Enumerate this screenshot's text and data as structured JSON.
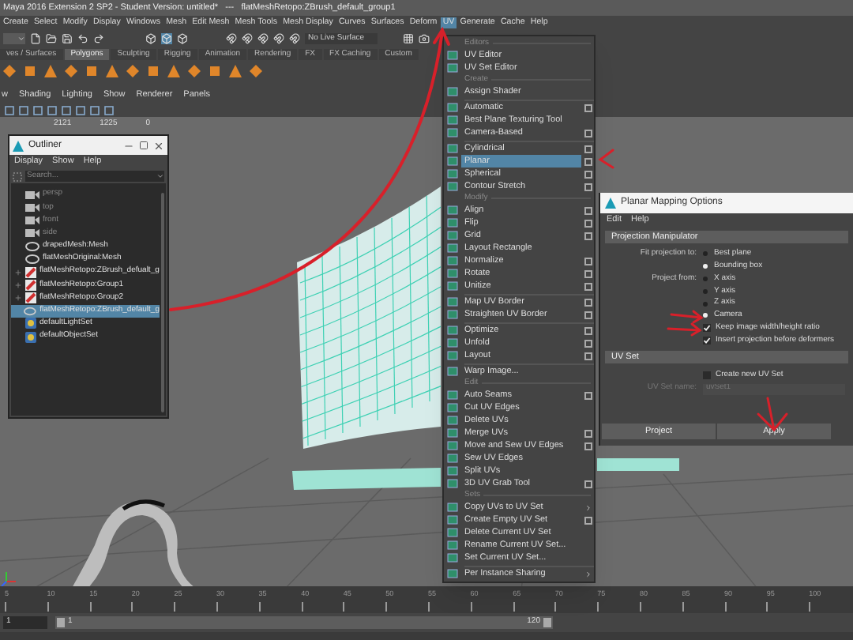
{
  "title": "Maya 2016 Extension 2 SP2 - Student Version: untitled*   ---   flatMeshRetopo:ZBrush_default_group1",
  "menu_bar": [
    {
      "label": "Create",
      "selected": false
    },
    {
      "label": "Select",
      "selected": false
    },
    {
      "label": "Modify",
      "selected": false
    },
    {
      "label": "Display",
      "selected": false
    },
    {
      "label": "Windows",
      "selected": false
    },
    {
      "label": "Mesh",
      "selected": false
    },
    {
      "label": "Edit Mesh",
      "selected": false
    },
    {
      "label": "Mesh Tools",
      "selected": false
    },
    {
      "label": "Mesh Display",
      "selected": false
    },
    {
      "label": "Curves",
      "selected": false
    },
    {
      "label": "Surfaces",
      "selected": false
    },
    {
      "label": "Deform",
      "selected": false
    },
    {
      "label": "UV",
      "selected": true
    },
    {
      "label": "Generate",
      "selected": false
    },
    {
      "label": "Cache",
      "selected": false
    },
    {
      "label": "Help",
      "selected": false
    }
  ],
  "toolbar": {
    "live_surface": "No Live Surface"
  },
  "shelf_tabs": [
    {
      "label": "ves / Surfaces",
      "selected": false
    },
    {
      "label": "Polygons",
      "selected": true
    },
    {
      "label": "Sculpting",
      "selected": false
    },
    {
      "label": "Rigging",
      "selected": false
    },
    {
      "label": "Animation",
      "selected": false
    },
    {
      "label": "Rendering",
      "selected": false
    },
    {
      "label": "FX",
      "selected": false
    },
    {
      "label": "FX Caching",
      "selected": false
    },
    {
      "label": "Custom",
      "selected": false
    }
  ],
  "panel_menu": [
    "w",
    "Shading",
    "Lighting",
    "Show",
    "Renderer",
    "Panels"
  ],
  "stats": [
    "2121",
    "1225",
    "0"
  ],
  "outliner": {
    "title": "Outliner",
    "menu": [
      "Display",
      "Show",
      "Help"
    ],
    "search": {
      "placeholder": "Search..."
    },
    "items": [
      {
        "label": "persp",
        "kind": "camera",
        "dimmed": true,
        "expandable": false,
        "selected": false
      },
      {
        "label": "top",
        "kind": "camera",
        "dimmed": true,
        "expandable": false,
        "selected": false
      },
      {
        "label": "front",
        "kind": "camera",
        "dimmed": true,
        "expandable": false,
        "selected": false
      },
      {
        "label": "side",
        "kind": "camera",
        "dimmed": true,
        "expandable": false,
        "selected": false
      },
      {
        "label": "drapedMesh:Mesh",
        "kind": "mesh",
        "dimmed": false,
        "expandable": false,
        "selected": false
      },
      {
        "label": "flatMeshOriginal:Mesh",
        "kind": "mesh",
        "dimmed": false,
        "expandable": false,
        "selected": false
      },
      {
        "label": "flatMeshRetopo:ZBrush_defualt_g",
        "kind": "group",
        "dimmed": false,
        "expandable": true,
        "selected": false
      },
      {
        "label": "flatMeshRetopo:Group1",
        "kind": "group",
        "dimmed": false,
        "expandable": true,
        "selected": false
      },
      {
        "label": "flatMeshRetopo:Group2",
        "kind": "group",
        "dimmed": false,
        "expandable": true,
        "selected": false
      },
      {
        "label": "flatMeshRetopo:ZBrush_default_g",
        "kind": "mesh",
        "dimmed": false,
        "expandable": false,
        "selected": true
      },
      {
        "label": "defaultLightSet",
        "kind": "set",
        "dimmed": false,
        "expandable": false,
        "selected": false
      },
      {
        "label": "defaultObjectSet",
        "kind": "set",
        "dimmed": false,
        "expandable": false,
        "selected": false
      }
    ]
  },
  "uv_menu": [
    {
      "kind": "section",
      "label": "Editors"
    },
    {
      "kind": "item",
      "label": "UV Editor",
      "option_box": false,
      "submenu": false,
      "selected": false
    },
    {
      "kind": "item",
      "label": "UV Set Editor",
      "option_box": false,
      "submenu": false,
      "selected": false
    },
    {
      "kind": "section",
      "label": "Create"
    },
    {
      "kind": "item",
      "label": "Assign Shader",
      "option_box": false,
      "submenu": false,
      "selected": false
    },
    {
      "kind": "divider"
    },
    {
      "kind": "item",
      "label": "Automatic",
      "option_box": true,
      "submenu": false,
      "selected": false
    },
    {
      "kind": "item",
      "label": "Best Plane Texturing Tool",
      "option_box": false,
      "submenu": false,
      "selected": false
    },
    {
      "kind": "item",
      "label": "Camera-Based",
      "option_box": true,
      "submenu": false,
      "selected": false
    },
    {
      "kind": "divider"
    },
    {
      "kind": "item",
      "label": "Cylindrical",
      "option_box": true,
      "submenu": false,
      "selected": false
    },
    {
      "kind": "item",
      "label": "Planar",
      "option_box": true,
      "submenu": false,
      "selected": true
    },
    {
      "kind": "item",
      "label": "Spherical",
      "option_box": true,
      "submenu": false,
      "selected": false
    },
    {
      "kind": "item",
      "label": "Contour Stretch",
      "option_box": true,
      "submenu": false,
      "selected": false
    },
    {
      "kind": "section",
      "label": "Modify"
    },
    {
      "kind": "item",
      "label": "Align",
      "option_box": true,
      "submenu": false,
      "selected": false
    },
    {
      "kind": "item",
      "label": "Flip",
      "option_box": true,
      "submenu": false,
      "selected": false
    },
    {
      "kind": "item",
      "label": "Grid",
      "option_box": true,
      "submenu": false,
      "selected": false
    },
    {
      "kind": "item",
      "label": "Layout Rectangle",
      "option_box": false,
      "submenu": false,
      "selected": false
    },
    {
      "kind": "item",
      "label": "Normalize",
      "option_box": true,
      "submenu": false,
      "selected": false
    },
    {
      "kind": "item",
      "label": "Rotate",
      "option_box": true,
      "submenu": false,
      "selected": false
    },
    {
      "kind": "item",
      "label": "Unitize",
      "option_box": true,
      "submenu": false,
      "selected": false
    },
    {
      "kind": "divider"
    },
    {
      "kind": "item",
      "label": "Map UV Border",
      "option_box": true,
      "submenu": false,
      "selected": false
    },
    {
      "kind": "item",
      "label": "Straighten UV Border",
      "option_box": true,
      "submenu": false,
      "selected": false
    },
    {
      "kind": "divider"
    },
    {
      "kind": "item",
      "label": "Optimize",
      "option_box": true,
      "submenu": false,
      "selected": false
    },
    {
      "kind": "item",
      "label": "Unfold",
      "option_box": true,
      "submenu": false,
      "selected": false
    },
    {
      "kind": "item",
      "label": "Layout",
      "option_box": true,
      "submenu": false,
      "selected": false
    },
    {
      "kind": "divider"
    },
    {
      "kind": "item",
      "label": "Warp Image...",
      "option_box": false,
      "submenu": false,
      "selected": false
    },
    {
      "kind": "section",
      "label": "Edit"
    },
    {
      "kind": "item",
      "label": "Auto Seams",
      "option_box": true,
      "submenu": false,
      "selected": false
    },
    {
      "kind": "item",
      "label": "Cut UV Edges",
      "option_box": false,
      "submenu": false,
      "selected": false
    },
    {
      "kind": "item",
      "label": "Delete UVs",
      "option_box": false,
      "submenu": false,
      "selected": false
    },
    {
      "kind": "item",
      "label": "Merge UVs",
      "option_box": true,
      "submenu": false,
      "selected": false
    },
    {
      "kind": "item",
      "label": "Move and Sew UV Edges",
      "option_box": true,
      "submenu": false,
      "selected": false
    },
    {
      "kind": "item",
      "label": "Sew UV Edges",
      "option_box": false,
      "submenu": false,
      "selected": false
    },
    {
      "kind": "item",
      "label": "Split UVs",
      "option_box": false,
      "submenu": false,
      "selected": false
    },
    {
      "kind": "item",
      "label": "3D UV Grab Tool",
      "option_box": true,
      "submenu": false,
      "selected": false
    },
    {
      "kind": "section",
      "label": "Sets"
    },
    {
      "kind": "item",
      "label": "Copy UVs to UV Set",
      "option_box": false,
      "submenu": true,
      "selected": false
    },
    {
      "kind": "item",
      "label": "Create Empty UV Set",
      "option_box": true,
      "submenu": false,
      "selected": false
    },
    {
      "kind": "item",
      "label": "Delete Current UV Set",
      "option_box": false,
      "submenu": false,
      "selected": false
    },
    {
      "kind": "item",
      "label": "Rename Current UV Set...",
      "option_box": false,
      "submenu": false,
      "selected": false
    },
    {
      "kind": "item",
      "label": "Set Current UV Set...",
      "option_box": false,
      "submenu": false,
      "selected": false
    },
    {
      "kind": "divider"
    },
    {
      "kind": "item",
      "label": "Per Instance Sharing",
      "option_box": false,
      "submenu": true,
      "selected": false
    }
  ],
  "dialog": {
    "title": "Planar Mapping Options",
    "menu": [
      "Edit",
      "Help"
    ],
    "sections": [
      {
        "title": "Projection Manipulator",
        "rows": [
          {
            "kind": "radio",
            "label": "Fit projection to:",
            "option": "Best plane",
            "selected": false
          },
          {
            "kind": "radio",
            "option": "Bounding box",
            "selected": true
          },
          {
            "kind": "radio",
            "label": "Project from:",
            "option": "X axis",
            "selected": false
          },
          {
            "kind": "radio",
            "option": "Y axis",
            "selected": false
          },
          {
            "kind": "radio",
            "option": "Z axis",
            "selected": false
          },
          {
            "kind": "radio",
            "option": "Camera",
            "selected": true
          },
          {
            "kind": "checkbox",
            "option": "Keep image width/height ratio",
            "checked": true
          },
          {
            "kind": "checkbox",
            "option": "Insert projection before deformers",
            "checked": true
          }
        ]
      },
      {
        "title": "UV Set",
        "rows": [
          {
            "kind": "checkbox",
            "option": "Create new UV Set",
            "checked": false
          },
          {
            "kind": "field",
            "label": "UV Set name:",
            "value": "uvSet1",
            "disabled": true
          }
        ]
      }
    ],
    "buttons": [
      "Project",
      "Apply"
    ]
  },
  "timeline": [
    "5",
    "10",
    "15",
    "20",
    "25",
    "30",
    "35",
    "40",
    "45",
    "50",
    "55",
    "60",
    "65",
    "70",
    "75",
    "80",
    "85",
    "90",
    "95",
    "100"
  ],
  "range": {
    "current": "1",
    "start": "1",
    "end": "120"
  }
}
